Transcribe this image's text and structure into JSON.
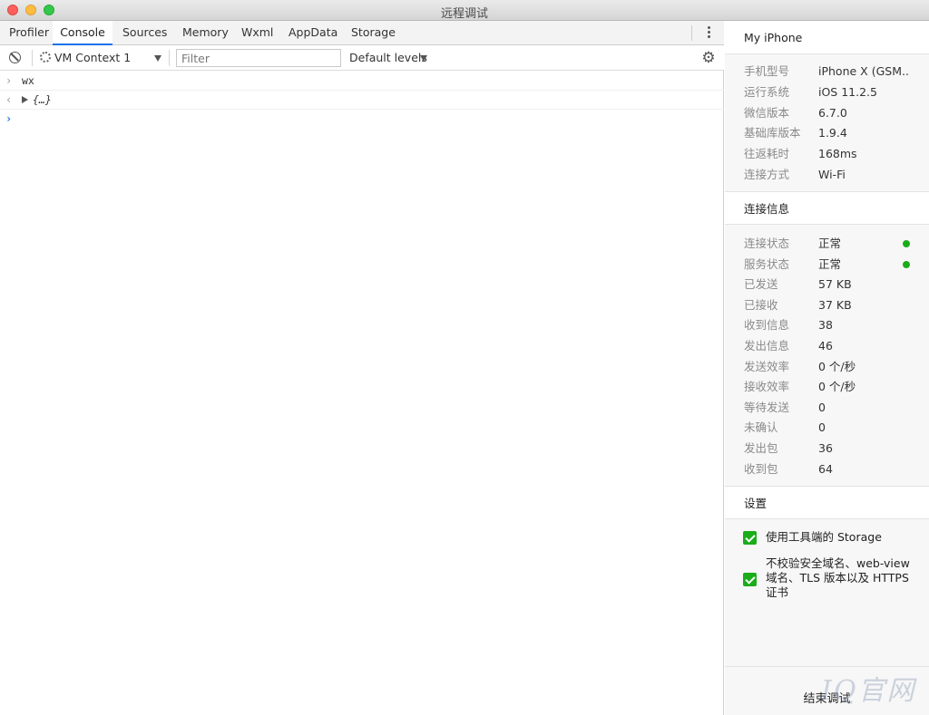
{
  "window": {
    "title": "远程调试"
  },
  "tabs": [
    "Profiler",
    "Console",
    "Sources",
    "Memory",
    "Wxml",
    "AppData",
    "Storage"
  ],
  "toolbar": {
    "context": "VM Context 1",
    "filter_placeholder": "Filter",
    "levels": "Default levels"
  },
  "console": {
    "lines": [
      {
        "type": "input",
        "text": "wx"
      },
      {
        "type": "output",
        "text": "{…}"
      },
      {
        "type": "prompt",
        "text": ""
      }
    ]
  },
  "device": {
    "title": "My iPhone",
    "rows": [
      {
        "key": "手机型号",
        "value": "iPhone X (GSM..."
      },
      {
        "key": "运行系统",
        "value": "iOS 11.2.5"
      },
      {
        "key": "微信版本",
        "value": "6.7.0"
      },
      {
        "key": "基础库版本",
        "value": "1.9.4"
      },
      {
        "key": "往返耗时",
        "value": "168ms"
      },
      {
        "key": "连接方式",
        "value": "Wi-Fi"
      }
    ]
  },
  "connection": {
    "title": "连接信息",
    "status_color": "#1aad19",
    "rows": [
      {
        "key": "连接状态",
        "value": "正常"
      },
      {
        "key": "服务状态",
        "value": "正常"
      },
      {
        "key": "已发送",
        "value": "57 KB"
      },
      {
        "key": "已接收",
        "value": "37 KB"
      },
      {
        "key": "收到信息",
        "value": "38"
      },
      {
        "key": "发出信息",
        "value": "46"
      },
      {
        "key": "发送效率",
        "value": "0 个/秒"
      },
      {
        "key": "接收效率",
        "value": "0 个/秒"
      },
      {
        "key": "等待发送",
        "value": "0"
      },
      {
        "key": "未确认",
        "value": "0"
      },
      {
        "key": "发出包",
        "value": "36"
      },
      {
        "key": "收到包",
        "value": "64"
      }
    ]
  },
  "settings": {
    "title": "设置",
    "options": [
      {
        "label": "使用工具端的 Storage",
        "checked": true
      },
      {
        "label": "不校验安全域名、web-view 域名、TLS 版本以及 HTTPS 证书",
        "checked": true
      }
    ]
  },
  "footer": {
    "end_label": "结束调试"
  },
  "watermark": "IQ官网"
}
